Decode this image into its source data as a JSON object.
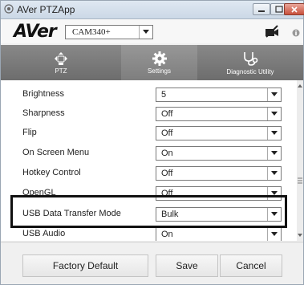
{
  "window": {
    "title": "AVer PTZApp"
  },
  "toolbar": {
    "logo": "AVer",
    "camera_select": {
      "value": "CAM340+"
    }
  },
  "tabs": [
    {
      "label": "PTZ",
      "icon": "ptz-icon",
      "active": false
    },
    {
      "label": "Settings",
      "icon": "gear-icon",
      "active": true
    },
    {
      "label": "Diagnostic Utility",
      "icon": "stethoscope-icon",
      "active": false
    }
  ],
  "settings": [
    {
      "label": "Brightness",
      "value": "5"
    },
    {
      "label": "Sharpness",
      "value": "Off"
    },
    {
      "label": "Flip",
      "value": "Off"
    },
    {
      "label": "On Screen Menu",
      "value": "On"
    },
    {
      "label": "Hotkey Control",
      "value": "Off"
    },
    {
      "label": "OpenGL",
      "value": "Off"
    },
    {
      "label": "USB Data Transfer Mode",
      "value": "Bulk"
    },
    {
      "label": "USB Audio",
      "value": "On"
    }
  ],
  "footer": {
    "factory_default": "Factory Default",
    "save": "Save",
    "cancel": "Cancel"
  },
  "colors": {
    "tab_bar": "#7a7a7a",
    "highlight_border": "#111111"
  }
}
